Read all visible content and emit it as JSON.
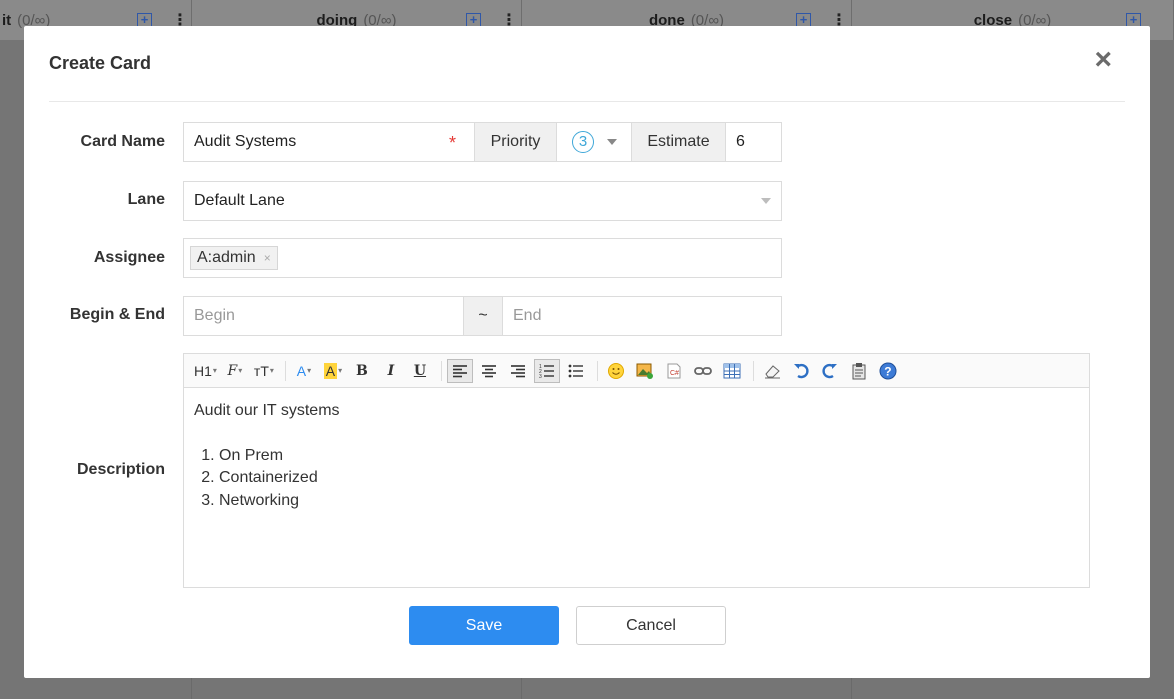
{
  "board": {
    "columns": [
      {
        "name": "it",
        "count": "(0/∞)"
      },
      {
        "name": "doing",
        "count": "(0/∞)"
      },
      {
        "name": "done",
        "count": "(0/∞)"
      },
      {
        "name": "close",
        "count": "(0/∞)"
      }
    ]
  },
  "dialog": {
    "title": "Create Card",
    "close_icon": "×"
  },
  "form": {
    "card_name": {
      "label": "Card Name",
      "value": "Audit Systems",
      "required_mark": "*"
    },
    "priority": {
      "label": "Priority",
      "value": "3"
    },
    "estimate": {
      "label": "Estimate",
      "value": "6"
    },
    "lane": {
      "label": "Lane",
      "value": "Default Lane"
    },
    "assignee": {
      "label": "Assignee",
      "tag": "A:admin",
      "tag_remove": "×"
    },
    "begin_end": {
      "label": "Begin & End",
      "begin_placeholder": "Begin",
      "separator": "~",
      "end_placeholder": "End"
    },
    "description": {
      "label": "Description",
      "text": "Audit our IT systems",
      "list": [
        "On Prem",
        "Containerized",
        "Networking"
      ]
    }
  },
  "toolbar": {
    "heading": "H1",
    "font_family": "F",
    "font_size": "тT",
    "font_color": "A",
    "bg_color": "A",
    "bold": "B",
    "italic": "I",
    "underline": "U"
  },
  "buttons": {
    "save": "Save",
    "cancel": "Cancel"
  },
  "colors": {
    "primary": "#2d8cf0",
    "priority_circle": "#3fa7d8",
    "required": "#e53935"
  }
}
